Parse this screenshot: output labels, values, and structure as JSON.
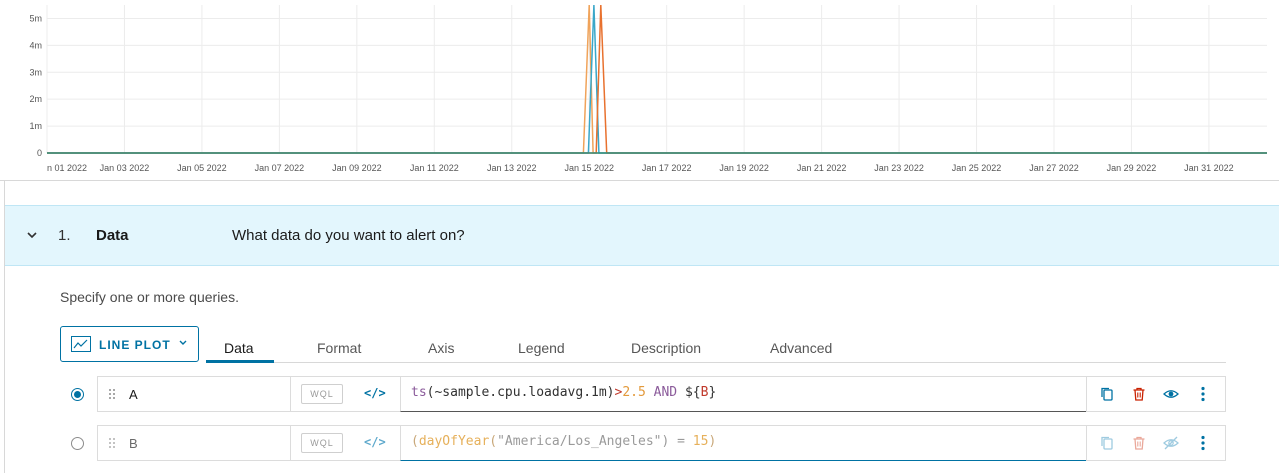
{
  "chart_data": {
    "type": "line",
    "title": "",
    "xlabel": "",
    "ylabel": "",
    "x_tick_labels": [
      "n 01 2022",
      "Jan 03 2022",
      "Jan 05 2022",
      "Jan 07 2022",
      "Jan 09 2022",
      "Jan 11 2022",
      "Jan 13 2022",
      "Jan 15 2022",
      "Jan 17 2022",
      "Jan 19 2022",
      "Jan 21 2022",
      "Jan 23 2022",
      "Jan 25 2022",
      "Jan 27 2022",
      "Jan 29 2022",
      "Jan 31 2022"
    ],
    "x_tick_days": [
      1,
      3,
      5,
      7,
      9,
      11,
      13,
      15,
      17,
      19,
      21,
      23,
      25,
      27,
      29,
      31
    ],
    "xlim_days": [
      1,
      32.5
    ],
    "y_tick_labels": [
      "0",
      "1m",
      "2m",
      "3m",
      "4m",
      "5m"
    ],
    "ylim": [
      0,
      5.5
    ],
    "grid": true,
    "legend": false,
    "series": [
      {
        "color": "#f0a35a",
        "x_days": [
          1,
          14.85,
          15.0,
          15.1,
          32.5
        ],
        "y": [
          0,
          0,
          5.5,
          0,
          0
        ]
      },
      {
        "color": "#3aa7c9",
        "x_days": [
          1,
          14.98,
          15.12,
          15.25,
          32.5
        ],
        "y": [
          0,
          0,
          5.5,
          0,
          0
        ]
      },
      {
        "color": "#e8712e",
        "x_days": [
          1,
          15.18,
          15.3,
          15.45,
          32.5
        ],
        "y": [
          0,
          0,
          5.5,
          0,
          0
        ]
      },
      {
        "color": "#2f8f7f",
        "x_days": [
          1,
          32.5
        ],
        "y": [
          0,
          0
        ]
      }
    ]
  },
  "section": {
    "number": "1.",
    "title": "Data",
    "question": "What data do you want to alert on?"
  },
  "hint": "Specify one or more queries.",
  "chart_type_button": {
    "label": "LINE PLOT"
  },
  "tabs": [
    "Data",
    "Format",
    "Axis",
    "Legend",
    "Description",
    "Advanced"
  ],
  "queries": [
    {
      "name": "A",
      "selected": true,
      "mode": "WQL",
      "code_toggle": "</>",
      "expr_parts": [
        {
          "text": "ts",
          "color": "#8a5a9a"
        },
        {
          "text": "(~sample.cpu.loadavg.1m)",
          "color": "#313131"
        },
        {
          "text": ">",
          "color": "#c0392b"
        },
        {
          "text": "2.5",
          "color": "#e39a3c"
        },
        {
          "text": " AND ",
          "color": "#8a5a9a"
        },
        {
          "text": "${",
          "color": "#313131"
        },
        {
          "text": "B",
          "color": "#c0392b"
        },
        {
          "text": "}",
          "color": "#313131"
        }
      ]
    },
    {
      "name": "B",
      "selected": false,
      "mode": "WQL",
      "code_toggle": "</>",
      "expr_parts": [
        {
          "text": "(",
          "color": "#c9a87a"
        },
        {
          "text": "dayOfYear",
          "color": "#e6b05a"
        },
        {
          "text": "(",
          "color": "#c9a87a"
        },
        {
          "text": "\"America/Los_Angeles\"",
          "color": "#9a9a9a"
        },
        {
          "text": ") = ",
          "color": "#9a9a9a"
        },
        {
          "text": "15",
          "color": "#e6b05a"
        },
        {
          "text": ")",
          "color": "#c9a87a"
        }
      ]
    }
  ],
  "colors": {
    "accent": "#0072a3",
    "delete": "#c92100",
    "header_bg": "#e3f6fd"
  }
}
